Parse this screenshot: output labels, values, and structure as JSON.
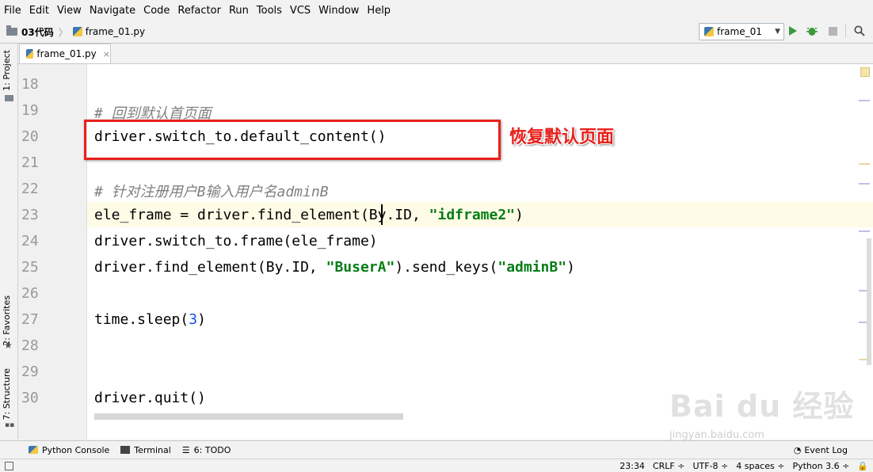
{
  "menu": [
    "File",
    "Edit",
    "View",
    "Navigate",
    "Code",
    "Refactor",
    "Run",
    "Tools",
    "VCS",
    "Window",
    "Help"
  ],
  "breadcrumb": {
    "project": "03代码",
    "file": "frame_01.py"
  },
  "run_config": "frame_01",
  "left_tabs": {
    "project": "1: Project",
    "favorites": "2: Favorites",
    "structure": "7: Structure"
  },
  "editor_tab": {
    "label": "frame_01.py",
    "close": "×"
  },
  "lines": [
    {
      "num": "18"
    },
    {
      "num": "19"
    },
    {
      "num": "20"
    },
    {
      "num": "21"
    },
    {
      "num": "22"
    },
    {
      "num": "23"
    },
    {
      "num": "24"
    },
    {
      "num": "25"
    },
    {
      "num": "26"
    },
    {
      "num": "27"
    },
    {
      "num": "28"
    },
    {
      "num": "29"
    },
    {
      "num": "30"
    }
  ],
  "code": {
    "l19_comment": "# 回到默认首页面",
    "l20": "driver.switch_to.default_content()",
    "l22_comment": "# 针对注册用户B输入用户名adminB",
    "l23_pre": "ele_frame = driver.find_element(By.ID, ",
    "l23_str": "\"idframe2\"",
    "l23_post": ")",
    "l24": "driver.switch_to.frame(ele_frame)",
    "l25_pre": "driver.find_element(By.ID, ",
    "l25_str1": "\"BuserA\"",
    "l25_mid": ").send_keys(",
    "l25_str2": "\"adminB\"",
    "l25_post": ")",
    "l27_pre": "time.sleep(",
    "l27_num": "3",
    "l27_post": ")",
    "l30": "driver.quit()"
  },
  "annotation": "恢复默认页面",
  "bottom_tools": [
    "Python Console",
    "Terminal",
    "6: TODO"
  ],
  "event_log": "Event Log",
  "status": {
    "position": "23:34",
    "line_sep": "CRLF",
    "encoding": "UTF-8",
    "indent": "4 spaces",
    "interpreter": "Python 3.6"
  },
  "watermark": {
    "main": "Bai du 经验",
    "sub": "jingyan.baidu.com"
  }
}
